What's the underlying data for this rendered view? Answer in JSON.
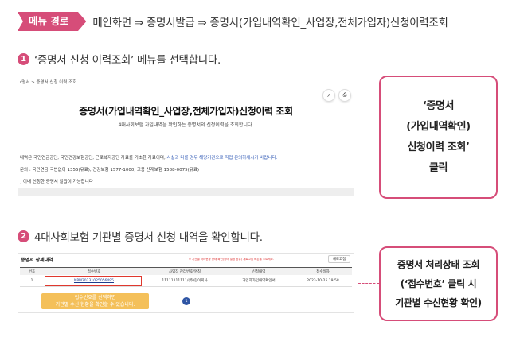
{
  "menu_path": {
    "badge": "메뉴 경로",
    "text": "메인화면 ⇒ 증명서발급 ⇒ 증명서(가입내역확인_사업장,전체가입자)신청이력조회"
  },
  "step1": {
    "number": "1",
    "text": "‘증명서 신청 이력조회’ 메뉴를 선택합니다.",
    "screen": {
      "breadcrumb": "r명서  >  증명서 신청 이력 조회",
      "icons": [
        "share-icon",
        "print-icon"
      ],
      "icon_glyphs": [
        "↗",
        "⎙"
      ],
      "title": "증명서(가입내역확인_사업장,전체가입자)신청이력 조회",
      "subtitle": "4대사회보험 가입내역을 확인하는 증명서의 신청이력을 조회합니다.",
      "notice_plain": "내역은 국민연금공단, 국민건강보험공단, 근로복지공단 자료를 기초한 자료이며, ",
      "notice_blue": "사실과 다를 경우 해당기관으로 직접 문의하세시기 바랍니다.",
      "contact": "문의 : 국민연금 국번없이 1355(유료), 건강보험 1577-1000, 고용 산재보험 1588-0075(유료)",
      "note": "] 이내 신청한 증명서 발급이 가능합니다"
    },
    "callout": [
      "‘증명서",
      "(가입내역확인)",
      "신청이력 조회’",
      "클릭"
    ]
  },
  "step2": {
    "number": "2",
    "text": "4대사회보험 기관별 증명서 신청 내역을 확인합니다.",
    "screen": {
      "title": "증명서 상세내역",
      "notice": "※ 기관별 처리현황 상태 확인(상태 결정 공유) 새로고침 버튼을 누르세요.",
      "refresh_button": "새로고침",
      "columns": [
        "번호",
        "접수번호",
        "사업장 관리번호/명칭",
        "신청내역",
        "접수일자"
      ],
      "rows": [
        [
          "1",
          "NPM20231025056495",
          "11111111111/(주)한이회사",
          "가입자가입내역확인서",
          "2023-10-25 19:58"
        ]
      ],
      "tooltip": [
        "접수번호를 선택하면",
        "기관별 수신 현황을 확인할 수 있습니다."
      ],
      "page": "1"
    },
    "callout": [
      "증명서 처리상태 조회",
      "(‘접수번호’ 클릭 시",
      "기관별 수신현황 확인)"
    ]
  },
  "colors": {
    "accent": "#d64d79",
    "link_blue": "#2b55b3",
    "highlight_red": "#e0382e",
    "tooltip_yellow": "#f4c05a",
    "page_blue": "#2f55a4"
  }
}
